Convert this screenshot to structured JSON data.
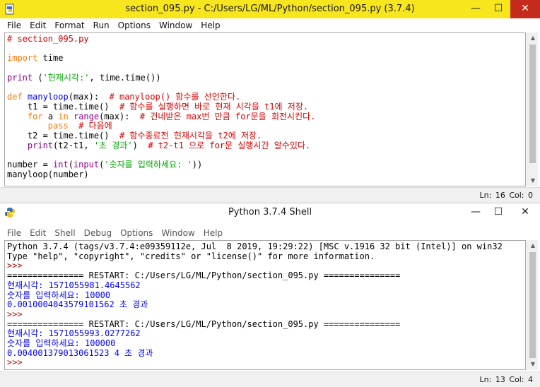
{
  "editor": {
    "title": "section_095.py - C:/Users/LG/ML/Python/section_095.py (3.7.4)",
    "menu": [
      "File",
      "Edit",
      "Format",
      "Run",
      "Options",
      "Window",
      "Help"
    ],
    "code": {
      "l1": "# section_095.py",
      "l3_kw": "import",
      "l3_rest": " time",
      "l5_fn": "print",
      "l5_a": " (",
      "l5_str": "'현재시각:'",
      "l5_b": ", time.time())",
      "l7_def": "def",
      "l7_sp": " ",
      "l7_name": "manyloop",
      "l7_args": "(max):  ",
      "l7_cm": "# manyloop() 함수를 선언한다.",
      "l8": "    t1 = time.time()  ",
      "l8_cm": "# 함수를 실행하면 바로 현재 시각을 t1에 저장.",
      "l9_ind": "    ",
      "l9_for": "for",
      "l9_a": " a ",
      "l9_in": "in",
      "l9_sp": " ",
      "l9_range": "range",
      "l9_b": "(max):  ",
      "l9_cm": "# 건네받은 max번 만큼 for문을 회전시킨다.",
      "l10_ind": "        ",
      "l10_pass": "pass",
      "l10_sp": "  ",
      "l10_cm": "# 다음에",
      "l11": "    t2 = time.time()  ",
      "l11_cm": "# 함수종료전 현재시각을 t2에 저장.",
      "l12_ind": "    ",
      "l12_print": "print",
      "l12_a": "(t2-t1, ",
      "l12_str": "'초 경과'",
      "l12_b": ")  ",
      "l12_cm": "# t2-t1 으로 for문 실행시간 알수있다.",
      "l14_a": "number = ",
      "l14_int": "int",
      "l14_b": "(",
      "l14_input": "input",
      "l14_c": "(",
      "l14_str": "'숫자를 입력하세요: '",
      "l14_d": "))",
      "l15": "manyloop(number)"
    },
    "status": "Ln: 16  Col: 0"
  },
  "shell": {
    "title": "Python 3.7.4 Shell",
    "menu": [
      "File",
      "Edit",
      "Shell",
      "Debug",
      "Options",
      "Window",
      "Help"
    ],
    "lines": {
      "banner1": "Python 3.7.4 (tags/v3.7.4:e09359112e, Jul  8 2019, 19:29:22) [MSC v.1916 32 bit (Intel)] on win32",
      "banner2": "Type \"help\", \"copyright\", \"credits\" or \"license()\" for more information.",
      "prompt": ">>> ",
      "restart": "=============== RESTART: C:/Users/LG/ML/Python/section_095.py ===============",
      "run1_time": "현재시각: 1571055981.4645562",
      "run1_input": "숫자를 입력하세요: 10000",
      "run1_elapsed": "0.0010004043579101562 초 경과",
      "run2_time": "현재시각: 1571055993.0277262",
      "run2_input": "숫자를 입력하세요: 100000",
      "run2_elapsed": "0.004001379013061523 4 초 경과"
    },
    "status": "Ln: 13  Col: 4"
  },
  "window_controls": {
    "minimize": "—",
    "maximize": "☐",
    "close": "✕"
  },
  "colors": {
    "editor_titlebar": "#f7e51d",
    "comment": "#dd0000",
    "keyword": "#ff7700",
    "string": "#00aa00",
    "output": "#0000ff",
    "builtin": "#900090"
  }
}
